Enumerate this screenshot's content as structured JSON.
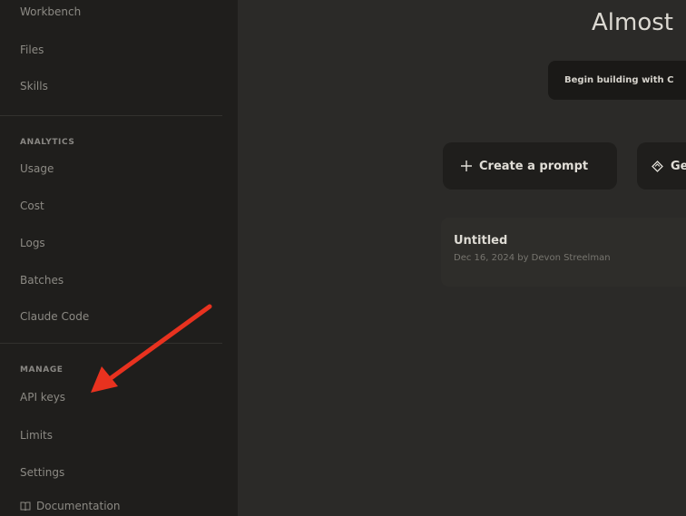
{
  "sidebar": {
    "top_items": [
      {
        "label": "Workbench"
      },
      {
        "label": "Files"
      },
      {
        "label": "Skills"
      }
    ],
    "analytics": {
      "heading": "ANALYTICS",
      "items": [
        {
          "label": "Usage"
        },
        {
          "label": "Cost"
        },
        {
          "label": "Logs"
        },
        {
          "label": "Batches"
        },
        {
          "label": "Claude Code"
        }
      ]
    },
    "manage": {
      "heading": "MANAGE",
      "items": [
        {
          "label": "API keys"
        },
        {
          "label": "Limits"
        },
        {
          "label": "Settings"
        }
      ]
    },
    "documentation": {
      "label": "Documentation",
      "icon": "book-icon"
    }
  },
  "main": {
    "title": "Almost",
    "banner_button": "Begin building with C",
    "actions": {
      "create_prompt": {
        "label": "Create a prompt",
        "icon": "plus-icon"
      },
      "get": {
        "label": "Ge",
        "icon": "diamond-icon"
      }
    },
    "recent_prompt": {
      "title": "Untitled",
      "meta": "Dec 16, 2024 by Devon Streelman"
    }
  },
  "annotation": {
    "color": "#e8321f",
    "icon": "red-arrow-annotation"
  }
}
